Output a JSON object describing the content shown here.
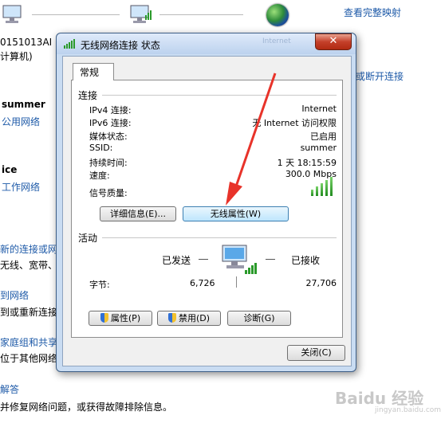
{
  "background": {
    "top_link": "查看完整映射",
    "pc_name": "0151013AI",
    "pc_sub": "计算机)",
    "disconnect_link": "或断开连接",
    "network1_name": "summer",
    "network1_type": "公用网络",
    "network2_name": "ice",
    "network2_type": "工作网络",
    "new_conn_link": "新的连接或网",
    "new_conn_desc": "无线、宽带、",
    "connect_link": "到网络",
    "connect_desc": "到或重新连接",
    "homegroup_link": "家庭组和共享",
    "homegroup_desc": "位于其他网络",
    "troubleshoot_link": "解答",
    "troubleshoot_desc": "并修复网络问题，或获得故障排除信息。",
    "internet_faded": "Internet"
  },
  "dialog": {
    "title": "无线网络连接 状态",
    "close_glyph": "✕",
    "tab_general": "常规",
    "connection_section": "连接",
    "rows": [
      {
        "label": "IPv4 连接:",
        "value": "Internet"
      },
      {
        "label": "IPv6 连接:",
        "value": "无 Internet 访问权限"
      },
      {
        "label": "媒体状态:",
        "value": "已启用"
      },
      {
        "label": "SSID:",
        "value": "summer"
      },
      {
        "label": "持续时间:",
        "value": "1 天 18:15:59"
      },
      {
        "label": "速度:",
        "value": "300.0 Mbps"
      }
    ],
    "signal_label": "信号质量:",
    "signal_level": 5,
    "details_button": "详细信息(E)...",
    "wireless_props_button": "无线属性(W)",
    "activity_section": "活动",
    "sent_label": "已发送",
    "received_label": "已接收",
    "bytes_label": "字节:",
    "bytes_sent": "6,726",
    "bytes_received": "27,706",
    "properties_button": "属性(P)",
    "disable_button": "禁用(D)",
    "diagnose_button": "诊断(G)",
    "close_button": "关闭(C)"
  },
  "colors": {
    "link": "#1e5aa8",
    "arrow": "#e8332a"
  }
}
